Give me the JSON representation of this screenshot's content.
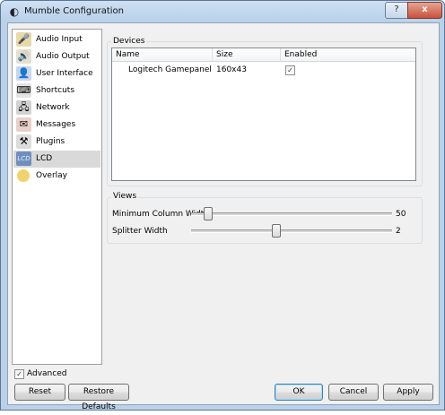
{
  "window": {
    "title": "Mumble Configuration",
    "help_label": "?",
    "close_label": "x"
  },
  "sidebar": {
    "items": [
      {
        "label": "Audio Input",
        "icon": "microphone-icon"
      },
      {
        "label": "Audio Output",
        "icon": "speaker-icon"
      },
      {
        "label": "User Interface",
        "icon": "user-interface-icon"
      },
      {
        "label": "Shortcuts",
        "icon": "shortcuts-icon"
      },
      {
        "label": "Network",
        "icon": "network-icon"
      },
      {
        "label": "Messages",
        "icon": "messages-icon"
      },
      {
        "label": "Plugins",
        "icon": "plugins-icon"
      },
      {
        "label": "LCD",
        "icon": "lcd-icon",
        "selected": true
      },
      {
        "label": "Overlay",
        "icon": "overlay-icon"
      }
    ]
  },
  "devices": {
    "title": "Devices",
    "columns": [
      "Name",
      "Size",
      "Enabled"
    ],
    "rows": [
      {
        "name": "Logitech Gamepanel",
        "size": "160x43",
        "enabled": true
      }
    ]
  },
  "views": {
    "title": "Views",
    "min_column_width": {
      "label": "Minimum Column Width",
      "value": "50",
      "fraction": 0.08
    },
    "splitter_width": {
      "label": "Splitter Width",
      "value": "2",
      "fraction": 0.42
    }
  },
  "footer": {
    "advanced_label": "Advanced",
    "advanced_checked": true,
    "reset_label": "Reset",
    "restore_label": "Restore Defaults",
    "ok_label": "OK",
    "cancel_label": "Cancel",
    "apply_label": "Apply"
  },
  "colors": {
    "selection": "#d9d9d9",
    "title_bar": "#b9d1ea",
    "close_button": "#c9513a"
  }
}
